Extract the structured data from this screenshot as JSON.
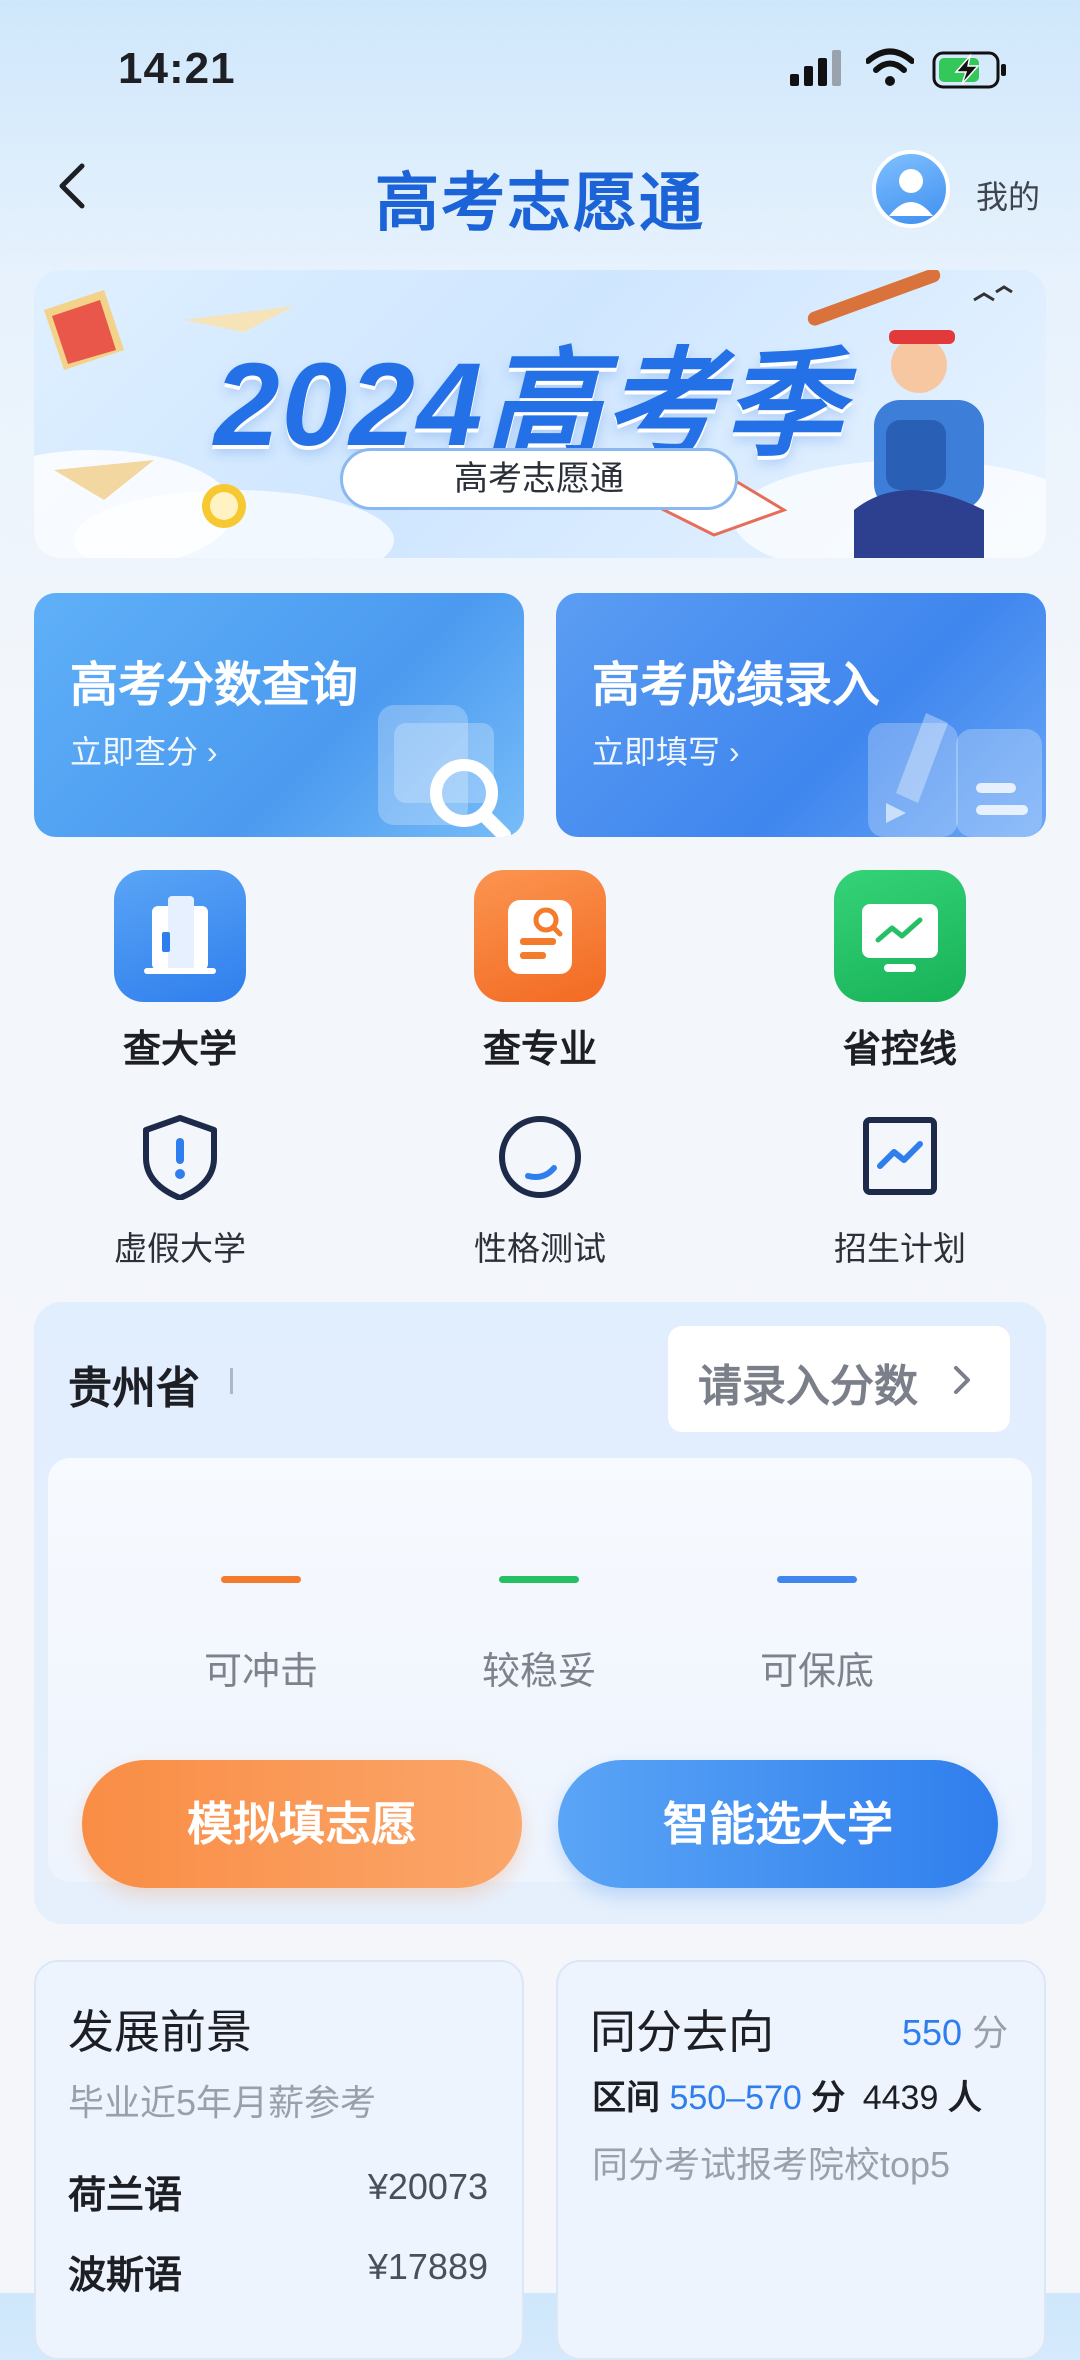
{
  "status_bar": {
    "time": "14:21"
  },
  "header": {
    "title": "高考志愿通",
    "mine_label": "我的"
  },
  "banner": {
    "title": "2024高考季",
    "subtitle": "高考志愿通"
  },
  "cards": [
    {
      "title": "高考分数查询",
      "action": "立即查分 ›"
    },
    {
      "title": "高考成绩录入",
      "action": "立即填写 ›"
    }
  ],
  "main_icons": [
    {
      "label": "查大学",
      "icon": "building-icon",
      "color": "#3f86ee"
    },
    {
      "label": "查专业",
      "icon": "document-search-icon",
      "color": "#f47a2c"
    },
    {
      "label": "省控线",
      "icon": "monitor-chart-icon",
      "color": "#24c063"
    }
  ],
  "sub_icons": [
    {
      "label": "虚假大学",
      "icon": "shield-alert-icon"
    },
    {
      "label": "性格测试",
      "icon": "circle-progress-icon"
    },
    {
      "label": "招生计划",
      "icon": "trend-chart-icon"
    }
  ],
  "province_panel": {
    "province": "贵州省",
    "enter_score": "请录入分数",
    "levels": [
      {
        "label": "可冲击",
        "color": "#f47a2c"
      },
      {
        "label": "较稳妥",
        "color": "#24c063"
      },
      {
        "label": "可保底",
        "color": "#3f86ee"
      }
    ],
    "btn_simulate": "模拟填志愿",
    "btn_smart": "智能选大学"
  },
  "prospects": {
    "title": "发展前景",
    "subtitle": "毕业近5年月薪参考",
    "rows": [
      {
        "name": "荷兰语",
        "salary": "¥20073"
      },
      {
        "name": "波斯语",
        "salary": "¥17889"
      }
    ]
  },
  "same_score": {
    "title": "同分去向",
    "score": "550",
    "score_unit": "分",
    "range_label": "区间",
    "range": "550–570",
    "range_unit": "分",
    "count": "4439",
    "count_unit": "人",
    "desc": "同分考试报考院校top5"
  }
}
